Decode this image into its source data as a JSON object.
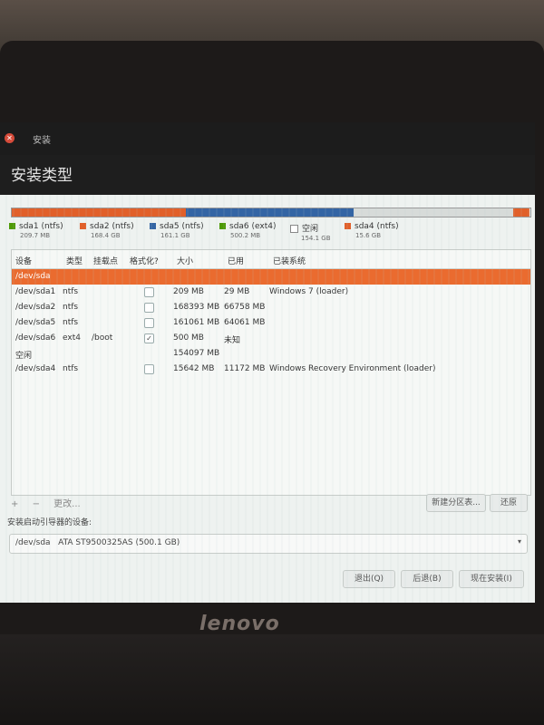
{
  "window": {
    "title": "安装"
  },
  "page": {
    "title": "安装类型"
  },
  "bar_segments": [
    {
      "color": "#e1602a",
      "fraction": 0.0004
    },
    {
      "color": "#e1602a",
      "fraction": 0.336
    },
    {
      "color": "#3465a4",
      "fraction": 0.322
    },
    {
      "color": "#4e9a06",
      "fraction": 0.001
    },
    {
      "color": "#d7dbd9",
      "fraction": 0.308
    },
    {
      "color": "#e1602a",
      "fraction": 0.031
    }
  ],
  "legend": [
    {
      "name": "sda1 (ntfs)",
      "size": "209.7 MB",
      "color": "#4e9a06"
    },
    {
      "name": "sda2 (ntfs)",
      "size": "168.4 GB",
      "color": "#e1602a"
    },
    {
      "name": "sda5 (ntfs)",
      "size": "161.1 GB",
      "color": "#3465a4"
    },
    {
      "name": "sda6 (ext4)",
      "size": "500.2 MB",
      "color": "#4e9a06"
    },
    {
      "name": "空闲",
      "size": "154.1 GB",
      "color": "#ffffff"
    },
    {
      "name": "sda4 (ntfs)",
      "size": "15.6 GB",
      "color": "#e1602a"
    }
  ],
  "table": {
    "headers": [
      "设备",
      "类型",
      "挂载点",
      "格式化?",
      "大小",
      "已用",
      "已装系统"
    ],
    "rows": [
      {
        "device": "/dev/sda",
        "type": "",
        "mount": "",
        "format": false,
        "size": "",
        "used": "",
        "system": "",
        "selected": true
      },
      {
        "device": "/dev/sda1",
        "type": "ntfs",
        "mount": "",
        "format": false,
        "size": "209 MB",
        "used": "29 MB",
        "system": "Windows 7 (loader)",
        "selected": false
      },
      {
        "device": "/dev/sda2",
        "type": "ntfs",
        "mount": "",
        "format": false,
        "size": "168393 MB",
        "used": "66758 MB",
        "system": "",
        "selected": false
      },
      {
        "device": "/dev/sda5",
        "type": "ntfs",
        "mount": "",
        "format": false,
        "size": "161061 MB",
        "used": "64061 MB",
        "system": "",
        "selected": false
      },
      {
        "device": "/dev/sda6",
        "type": "ext4",
        "mount": "/boot",
        "format": true,
        "size": "500 MB",
        "used": "未知",
        "system": "",
        "selected": false
      },
      {
        "device": "空闲",
        "type": "",
        "mount": "",
        "format": false,
        "size": "154097 MB",
        "used": "",
        "system": "",
        "selected": false
      },
      {
        "device": "/dev/sda4",
        "type": "ntfs",
        "mount": "",
        "format": false,
        "size": "15642 MB",
        "used": "11172 MB",
        "system": "Windows Recovery Environment (loader)",
        "selected": false
      }
    ]
  },
  "actions": {
    "add": "+",
    "remove": "−",
    "change": "更改...",
    "new_table": "新建分区表...",
    "revert": "还原"
  },
  "bootloader": {
    "label": "安装启动引导器的设备:",
    "value": "/dev/sda",
    "detail": "ATA ST9500325AS (500.1 GB)"
  },
  "buttons": {
    "quit": "退出(Q)",
    "back": "后退(B)",
    "install": "现在安装(I)"
  },
  "brand": "lenovo"
}
